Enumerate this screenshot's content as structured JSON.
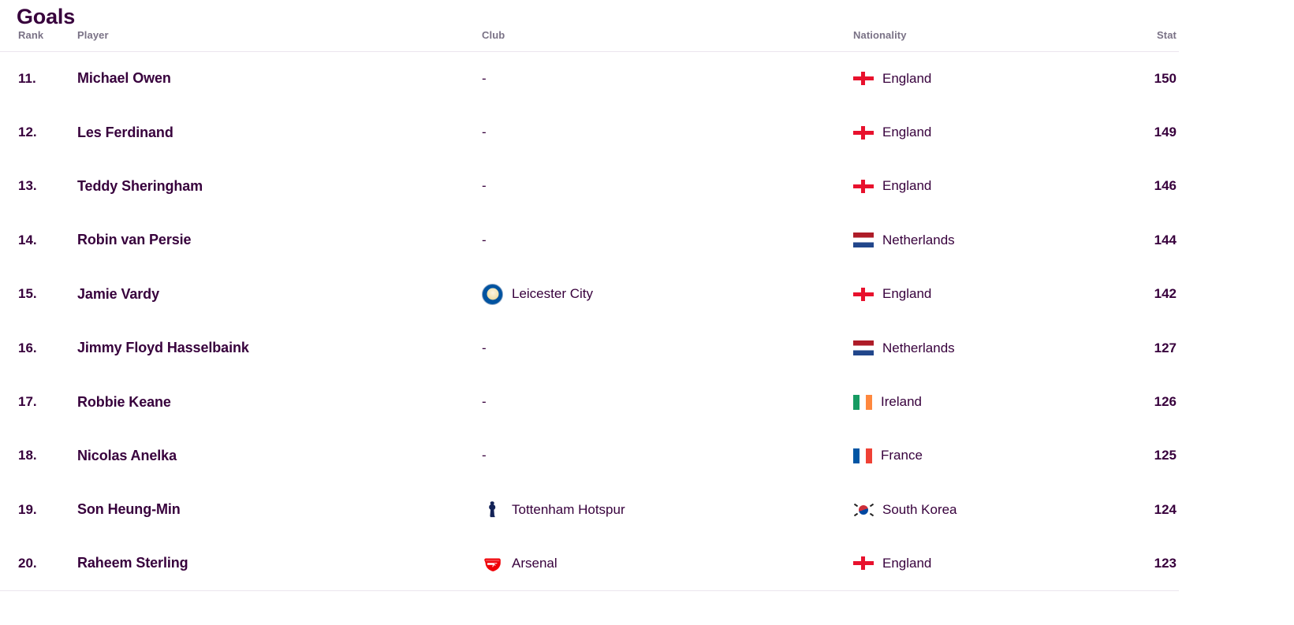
{
  "panel": {
    "title": "Goals"
  },
  "table": {
    "headers": {
      "rank": "Rank",
      "player": "Player",
      "club": "Club",
      "nationality": "Nationality",
      "stat": "Stat"
    },
    "empty_club_placeholder": "-",
    "rows": [
      {
        "rank": "11.",
        "player": "Michael Owen",
        "club": "",
        "club_badge": "",
        "nationality": "England",
        "flag": "england-flag-icon",
        "stat": "150"
      },
      {
        "rank": "12.",
        "player": "Les Ferdinand",
        "club": "",
        "club_badge": "",
        "nationality": "England",
        "flag": "england-flag-icon",
        "stat": "149"
      },
      {
        "rank": "13.",
        "player": "Teddy Sheringham",
        "club": "",
        "club_badge": "",
        "nationality": "England",
        "flag": "england-flag-icon",
        "stat": "146"
      },
      {
        "rank": "14.",
        "player": "Robin van Persie",
        "club": "",
        "club_badge": "",
        "nationality": "Netherlands",
        "flag": "netherlands-flag-icon",
        "stat": "144"
      },
      {
        "rank": "15.",
        "player": "Jamie Vardy",
        "club": "Leicester City",
        "club_badge": "leicester-city-badge-icon",
        "nationality": "England",
        "flag": "england-flag-icon",
        "stat": "142"
      },
      {
        "rank": "16.",
        "player": "Jimmy Floyd Hasselbaink",
        "club": "",
        "club_badge": "",
        "nationality": "Netherlands",
        "flag": "netherlands-flag-icon",
        "stat": "127"
      },
      {
        "rank": "17.",
        "player": "Robbie Keane",
        "club": "",
        "club_badge": "",
        "nationality": "Ireland",
        "flag": "ireland-flag-icon",
        "stat": "126"
      },
      {
        "rank": "18.",
        "player": "Nicolas Anelka",
        "club": "",
        "club_badge": "",
        "nationality": "France",
        "flag": "france-flag-icon",
        "stat": "125"
      },
      {
        "rank": "19.",
        "player": "Son Heung-Min",
        "club": "Tottenham Hotspur",
        "club_badge": "tottenham-hotspur-badge-icon",
        "nationality": "South Korea",
        "flag": "south-korea-flag-icon",
        "stat": "124"
      },
      {
        "rank": "20.",
        "player": "Raheem Sterling",
        "club": "Arsenal",
        "club_badge": "arsenal-badge-icon",
        "nationality": "England",
        "flag": "england-flag-icon",
        "stat": "123"
      }
    ]
  },
  "colors": {
    "brand_purple": "#37003C",
    "header_gray": "#7A7286",
    "divider": "#EBE5EE",
    "england_red": "#E8112D",
    "netherlands_red": "#AE1C28",
    "netherlands_blue": "#21468B",
    "ireland_green": "#169B62",
    "ireland_orange": "#FF883E",
    "france_blue": "#0055A4",
    "france_red": "#EF4135",
    "korea_red": "#CD2E3A",
    "korea_blue": "#0047A0",
    "leicester_blue": "#0053A0",
    "arsenal_red": "#EF0107",
    "tottenham_navy": "#132257"
  }
}
